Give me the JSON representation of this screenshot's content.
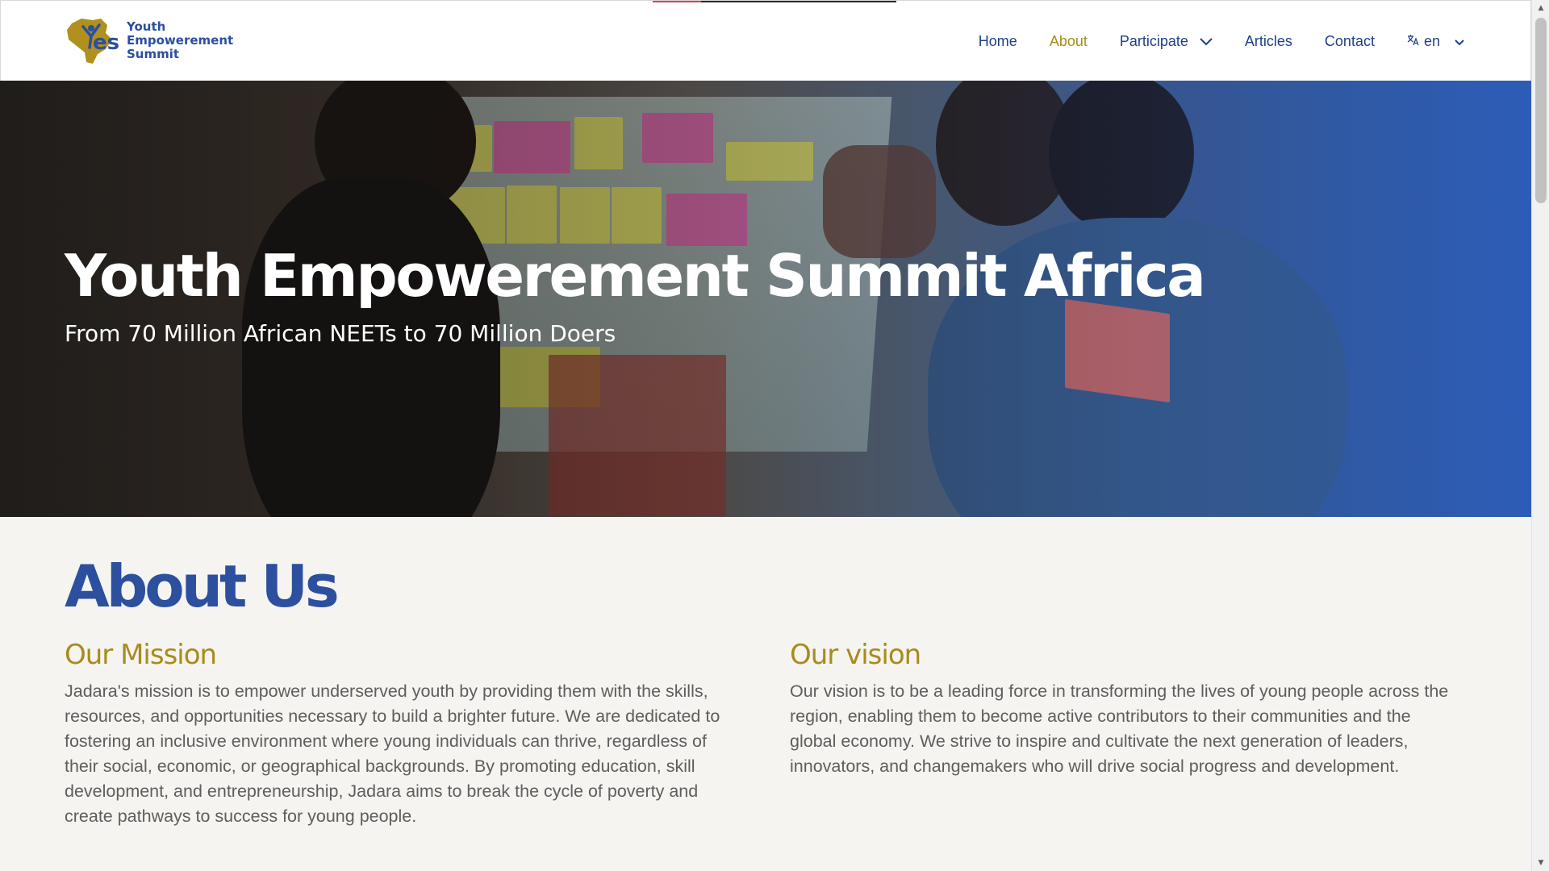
{
  "header": {
    "logo_lines": [
      "Youth",
      "Empowerement",
      "Summit"
    ],
    "nav": {
      "home": "Home",
      "about": "About",
      "participate": "Participate",
      "articles": "Articles",
      "contact": "Contact",
      "language": "en"
    }
  },
  "hero": {
    "title": "Youth Empowerement Summit Africa",
    "subtitle": "From 70 Million African NEETs to 70 Million Doers"
  },
  "about": {
    "heading": "About Us",
    "mission": {
      "title": "Our Mission",
      "text": "Jadara's mission is to empower underserved youth by providing them with the skills, resources, and opportunities necessary to build a brighter future. We are dedicated to fostering an inclusive environment where young individuals can thrive, regardless of their social, economic, or geographical backgrounds. By promoting education, skill development, and entrepreneurship, Jadara aims to break the cycle of poverty and create pathways to success for young people."
    },
    "vision": {
      "title": "Our vision",
      "text": "Our vision is to be a leading force in transforming the lives of young people across the region, enabling them to become active contributors to their communities and the global economy. We strive to inspire and cultivate the next generation of leaders, innovators, and changemakers who will drive social progress and development."
    }
  },
  "colors": {
    "brand_blue": "#2c4f9e",
    "brand_gold": "#a88b1d",
    "nav_blue": "#1f3f86",
    "body_text": "#5e5e5e",
    "background": "#f5f4f0"
  },
  "icons": [
    "logo-icon",
    "chevron-down-icon",
    "translate-icon",
    "scroll-up-arrow-icon",
    "scroll-down-arrow-icon"
  ]
}
